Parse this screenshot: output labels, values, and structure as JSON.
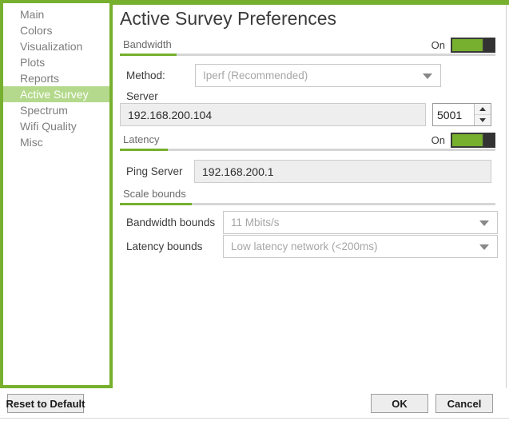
{
  "window": {
    "accent_color": "#76b02e",
    "highlight_color": "#b4d98c"
  },
  "sidebar": {
    "items": [
      {
        "label": "Main",
        "selected": false
      },
      {
        "label": "Colors",
        "selected": false
      },
      {
        "label": "Visualization",
        "selected": false
      },
      {
        "label": "Plots",
        "selected": false
      },
      {
        "label": "Reports",
        "selected": false
      },
      {
        "label": "Active Survey",
        "selected": true
      },
      {
        "label": "Spectrum",
        "selected": false
      },
      {
        "label": "Wifi Quality",
        "selected": false
      },
      {
        "label": "Misc",
        "selected": false
      }
    ]
  },
  "main": {
    "title": "Active Survey Preferences",
    "bandwidth_section": {
      "title": "Bandwidth",
      "toggle_label": "On",
      "toggle_state": "on",
      "method_label": "Method:",
      "method_value": "Iperf (Recommended)",
      "server_label": "Server",
      "server_value": "192.168.200.104",
      "port_value": "5001"
    },
    "latency_section": {
      "title": "Latency",
      "toggle_label": "On",
      "toggle_state": "on",
      "ping_server_label": "Ping Server",
      "ping_server_value": "192.168.200.1"
    },
    "scale_bounds_section": {
      "title": "Scale bounds",
      "bandwidth_bounds_label": "Bandwidth bounds",
      "bandwidth_bounds_value": "11 Mbits/s",
      "latency_bounds_label": "Latency bounds",
      "latency_bounds_value": "Low latency network (<200ms)"
    }
  },
  "footer": {
    "reset_label": "Reset to Default",
    "ok_label": "OK",
    "cancel_label": "Cancel"
  }
}
